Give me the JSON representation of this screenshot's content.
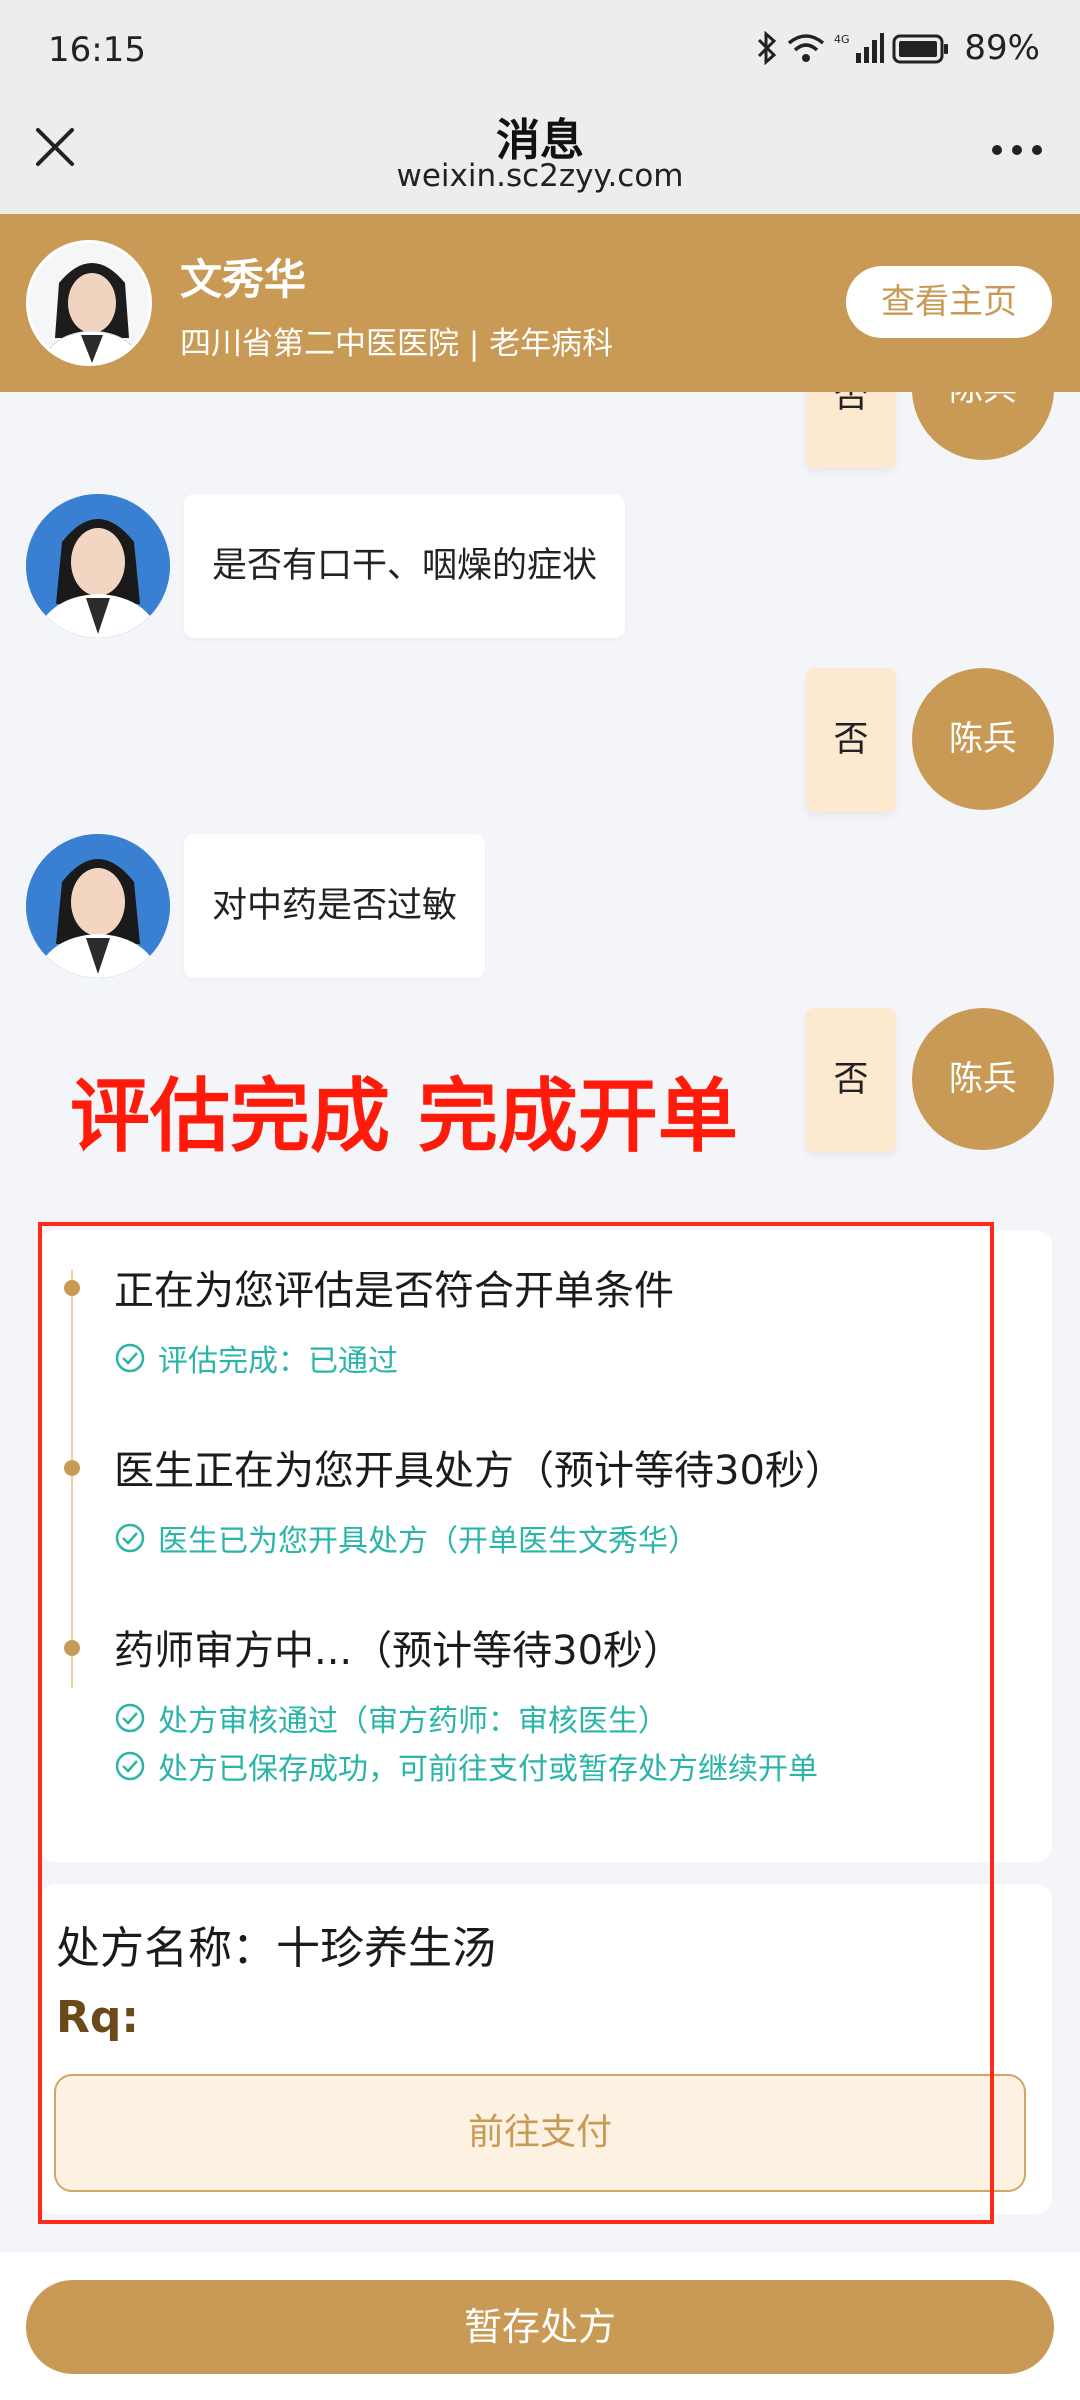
{
  "status_bar": {
    "time": "16:15",
    "network": "4G",
    "battery": "89%"
  },
  "title_bar": {
    "title": "消息",
    "subtitle": "weixin.sc2zyy.com"
  },
  "doctor": {
    "name": "文秀华",
    "hospital": "四川省第二中医医院 | 老年病科",
    "home_button": "查看主页"
  },
  "chat": {
    "patient_name": "陈兵",
    "messages": [
      {
        "side": "right",
        "text": "否"
      },
      {
        "side": "left",
        "text": "是否有口干、咽燥的症状"
      },
      {
        "side": "right",
        "text": "否"
      },
      {
        "side": "left",
        "text": "对中药是否过敏"
      },
      {
        "side": "right",
        "text": "否"
      }
    ],
    "overlay_annotation": "评估完成 完成开单"
  },
  "process": {
    "steps": [
      {
        "title": "正在为您评估是否符合开单条件",
        "notes": [
          "评估完成：已通过"
        ]
      },
      {
        "title": "医生正在为您开具处方（预计等待30秒）",
        "notes": [
          "医生已为您开具处方（开单医生文秀华）"
        ]
      },
      {
        "title": "药师审方中...（预计等待30秒）",
        "notes": [
          "处方审核通过（审方药师：审核医生）",
          "处方已保存成功，可前往支付或暂存处方继续开单"
        ]
      }
    ]
  },
  "prescription": {
    "name_label": "处方名称：十珍养生汤",
    "rq_label": "Rq:",
    "pay_button": "前往支付"
  },
  "footer": {
    "save_button": "暂存处方"
  },
  "colors": {
    "accent": "#c99a55",
    "check": "#2ab5a8",
    "annotation": "#ff1a0a",
    "bubble_right": "#fde9cf"
  },
  "icons": [
    "close-icon",
    "more-icon",
    "bluetooth-icon",
    "wifi-icon",
    "signal-icon",
    "battery-icon",
    "check-circle-icon"
  ]
}
